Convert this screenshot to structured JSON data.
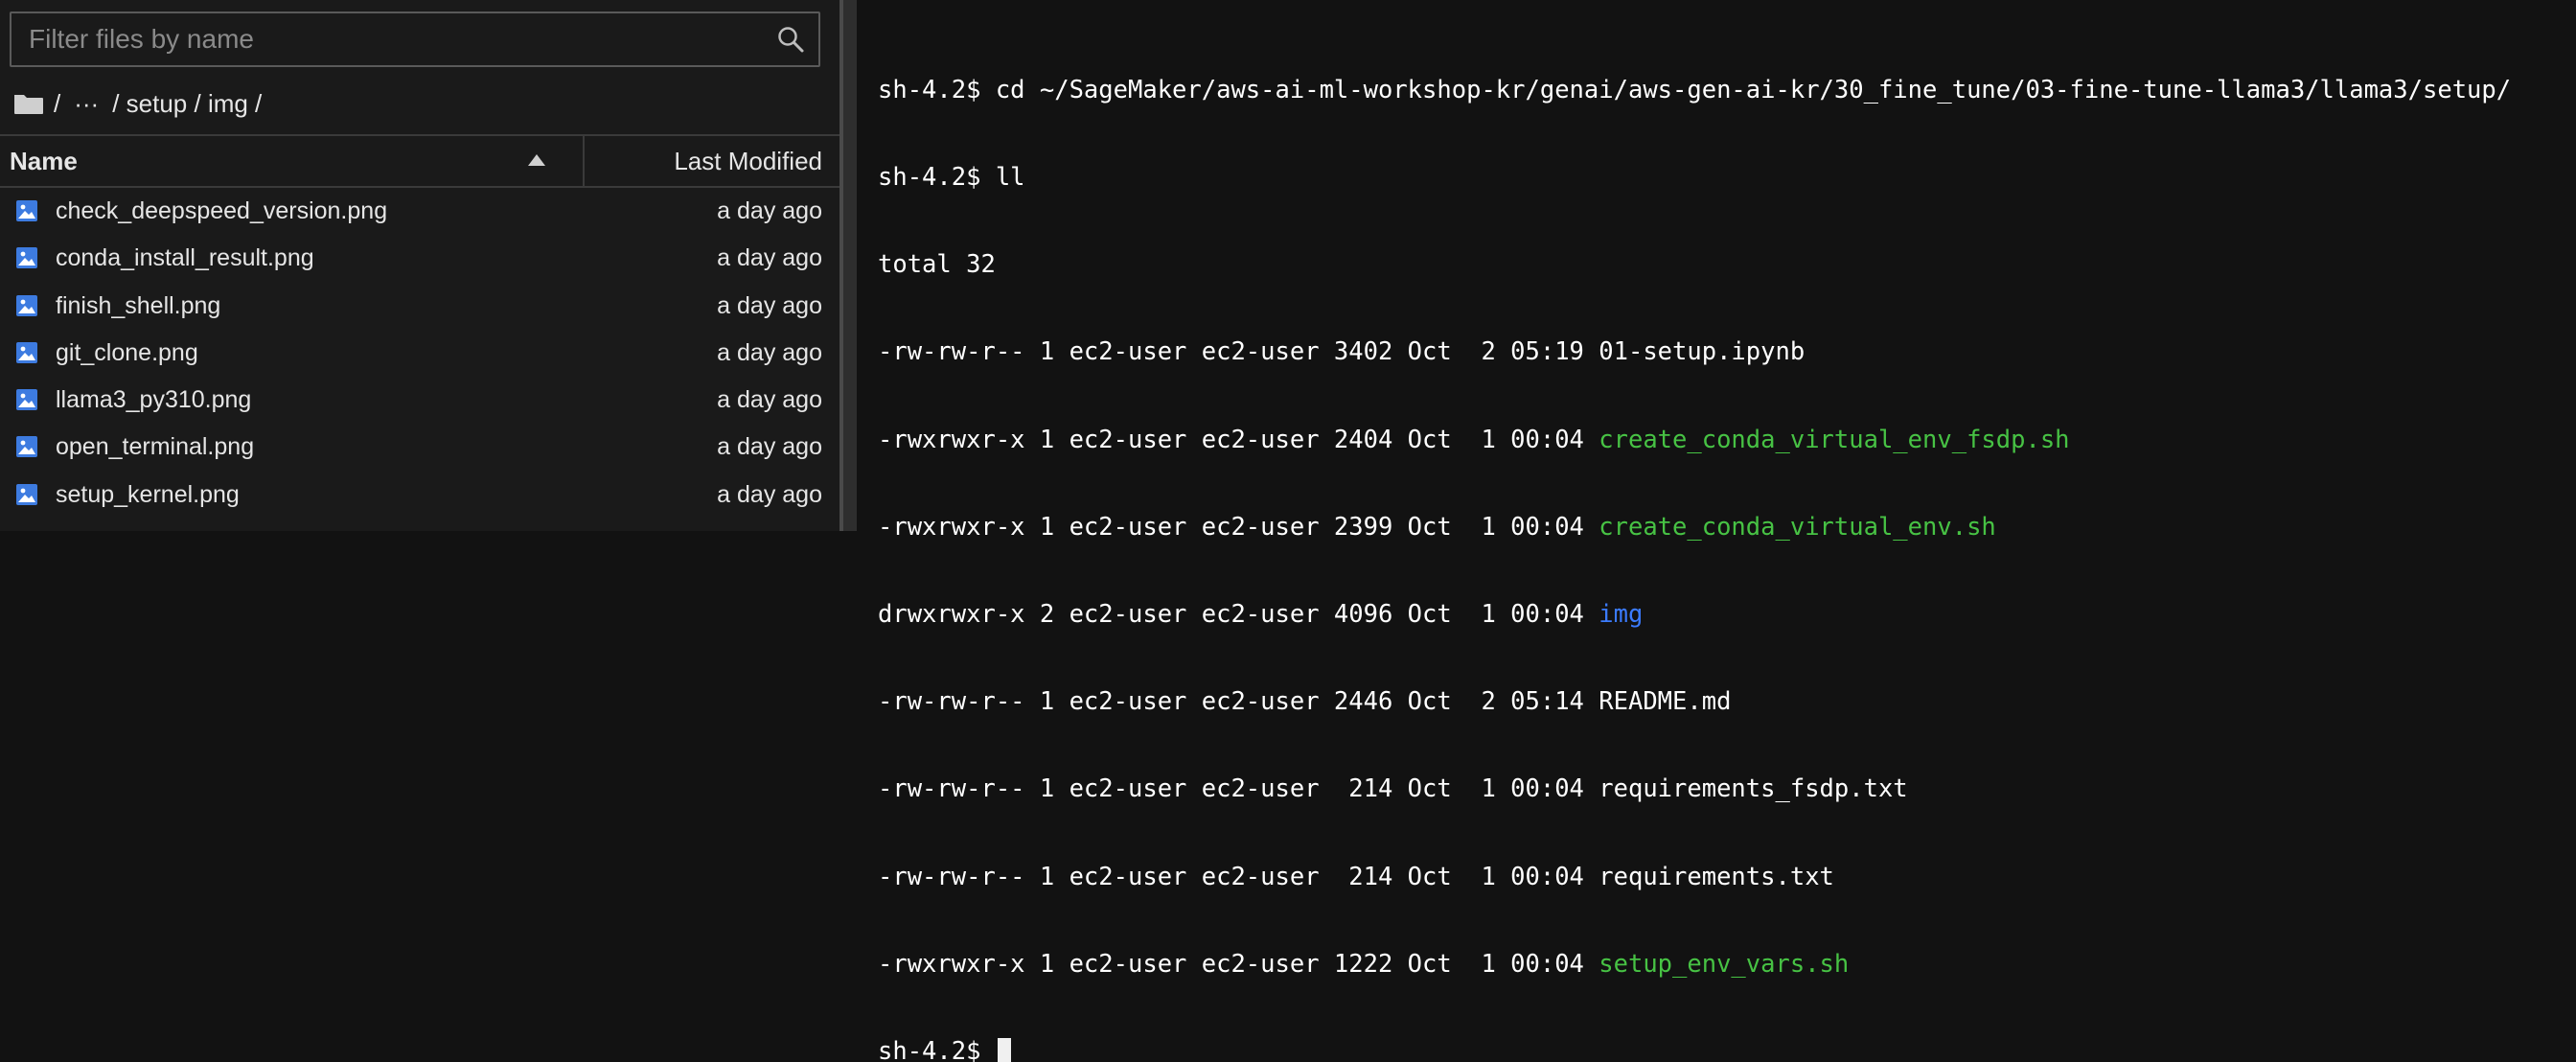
{
  "filebrowser": {
    "search": {
      "placeholder": "Filter files by name",
      "value": ""
    },
    "breadcrumb": {
      "root": "/",
      "ellipsis": "···",
      "path": "/ setup / img /"
    },
    "columns": {
      "name": "Name",
      "modified": "Last Modified"
    },
    "files": [
      {
        "name": "check_deepspeed_version.png",
        "modified": "a day ago"
      },
      {
        "name": "conda_install_result.png",
        "modified": "a day ago"
      },
      {
        "name": "finish_shell.png",
        "modified": "a day ago"
      },
      {
        "name": "git_clone.png",
        "modified": "a day ago"
      },
      {
        "name": "llama3_py310.png",
        "modified": "a day ago"
      },
      {
        "name": "open_terminal.png",
        "modified": "a day ago"
      },
      {
        "name": "setup_kernel.png",
        "modified": "a day ago"
      }
    ]
  },
  "terminal": {
    "lines": [
      {
        "segments": [
          {
            "text": "sh-4.2$ cd ~/SageMaker/aws-ai-ml-workshop-kr/genai/aws-gen-ai-kr/30_fine_tune/03-fine-tune-llama3/llama3/setup/",
            "color": "default"
          }
        ]
      },
      {
        "segments": [
          {
            "text": "sh-4.2$ ll",
            "color": "default"
          }
        ]
      },
      {
        "segments": [
          {
            "text": "total 32",
            "color": "default"
          }
        ]
      },
      {
        "segments": [
          {
            "text": "-rw-rw-r-- 1 ec2-user ec2-user 3402 Oct  2 05:19 ",
            "color": "default"
          },
          {
            "text": "01-setup.ipynb",
            "color": "default"
          }
        ]
      },
      {
        "segments": [
          {
            "text": "-rwxrwxr-x 1 ec2-user ec2-user 2404 Oct  1 00:04 ",
            "color": "default"
          },
          {
            "text": "create_conda_virtual_env_fsdp.sh",
            "color": "green"
          }
        ]
      },
      {
        "segments": [
          {
            "text": "-rwxrwxr-x 1 ec2-user ec2-user 2399 Oct  1 00:04 ",
            "color": "default"
          },
          {
            "text": "create_conda_virtual_env.sh",
            "color": "green"
          }
        ]
      },
      {
        "segments": [
          {
            "text": "drwxrwxr-x 2 ec2-user ec2-user 4096 Oct  1 00:04 ",
            "color": "default"
          },
          {
            "text": "img",
            "color": "blue"
          }
        ]
      },
      {
        "segments": [
          {
            "text": "-rw-rw-r-- 1 ec2-user ec2-user 2446 Oct  2 05:14 ",
            "color": "default"
          },
          {
            "text": "README.md",
            "color": "default"
          }
        ]
      },
      {
        "segments": [
          {
            "text": "-rw-rw-r-- 1 ec2-user ec2-user  214 Oct  1 00:04 ",
            "color": "default"
          },
          {
            "text": "requirements_fsdp.txt",
            "color": "default"
          }
        ]
      },
      {
        "segments": [
          {
            "text": "-rw-rw-r-- 1 ec2-user ec2-user  214 Oct  1 00:04 ",
            "color": "default"
          },
          {
            "text": "requirements.txt",
            "color": "default"
          }
        ]
      },
      {
        "segments": [
          {
            "text": "-rwxrwxr-x 1 ec2-user ec2-user 1222 Oct  1 00:04 ",
            "color": "default"
          },
          {
            "text": "setup_env_vars.sh",
            "color": "green"
          }
        ]
      }
    ],
    "prompt": "sh-4.2$ "
  },
  "colors": {
    "green": "#47c244",
    "blue": "#3b7bff",
    "file_icon": "#3d7be0"
  },
  "icons": {
    "search": "search-icon",
    "folder": "folder-icon",
    "sort": "sort-ascending-icon",
    "file": "image-file-icon"
  }
}
